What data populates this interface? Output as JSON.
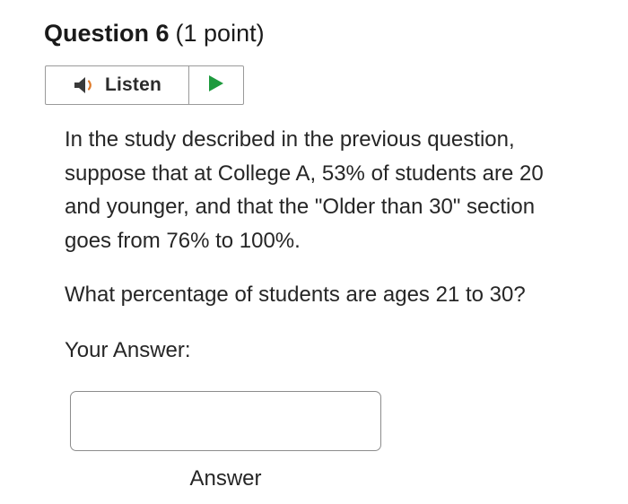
{
  "question": {
    "title": "Question 6",
    "points": "(1 point)"
  },
  "listen": {
    "label": "Listen",
    "speaker_icon": "speaker-icon",
    "play_icon": "play-icon",
    "speaker_color": "#3a3a3a",
    "speaker_wave_color": "#e07b2a",
    "play_color": "#1e9a3e"
  },
  "body": {
    "lines": [
      "In the study described in the previous question,",
      "suppose that at College A, 53% of students are 20",
      "and younger, and that the \"Older than 30\" section",
      "goes from 76% to 100%."
    ],
    "prompt": "What percentage of students are ages 21 to 30?"
  },
  "answer": {
    "heading": "Your Answer:",
    "value": "",
    "caption": "Answer"
  }
}
